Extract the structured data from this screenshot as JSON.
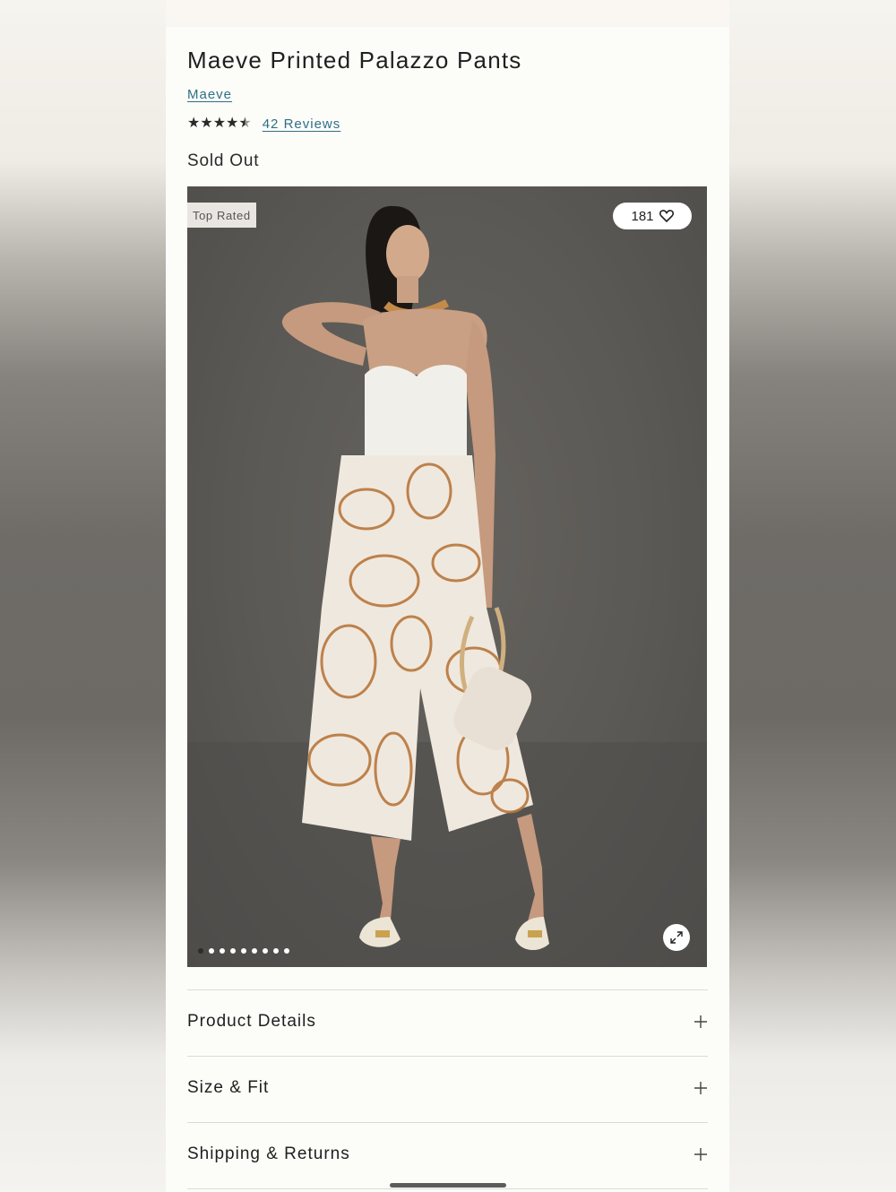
{
  "product": {
    "title": "Maeve Printed Palazzo Pants",
    "brand": "Maeve",
    "rating_stars": 4.5,
    "reviews_label": "42 Reviews",
    "availability": "Sold Out"
  },
  "gallery": {
    "badge": "Top Rated",
    "favorite_count": "181",
    "image_count": 9,
    "active_index": 0,
    "favorite_icon": "heart-icon",
    "expand_icon": "expand-icon"
  },
  "accordions": [
    {
      "label": "Product Details",
      "icon": "plus-icon"
    },
    {
      "label": "Size & Fit",
      "icon": "plus-icon"
    },
    {
      "label": "Shipping & Returns",
      "icon": "plus-icon"
    }
  ],
  "colors": {
    "link": "#2f6f86",
    "text": "#1f1f1f",
    "panel": "#fcfcf9"
  }
}
